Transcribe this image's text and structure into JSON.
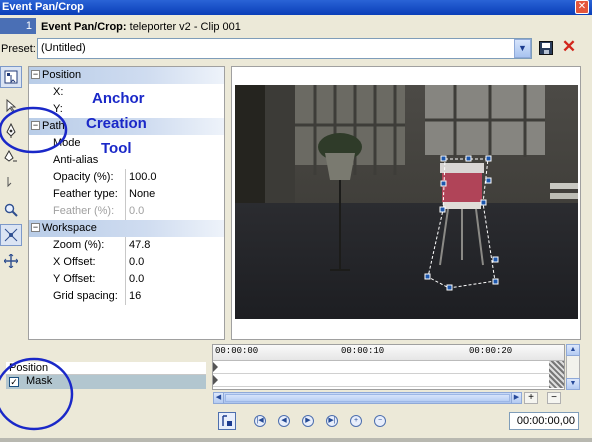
{
  "window": {
    "title": "Event Pan/Crop",
    "track_chip": "1"
  },
  "header": {
    "title_bold": "Event Pan/Crop:",
    "title_rest": " teleporter v2 - Clip 001"
  },
  "preset": {
    "label": "Preset:",
    "value": "(Untitled)"
  },
  "toolbar": {
    "tools": [
      "normal-edit-tool-icon",
      "pointer-tool-icon",
      "anchor-creation-tool-icon",
      "split-anchor-tool-icon",
      "delete-anchor-tool-icon",
      "zoom-tool-icon",
      "enable-snapping-icon",
      "move-freely-icon"
    ]
  },
  "properties": {
    "sections": [
      {
        "name": "Position",
        "rows": [
          {
            "key": "X:",
            "value": ""
          },
          {
            "key": "Y:",
            "value": ""
          }
        ]
      },
      {
        "name": "Path",
        "rows": [
          {
            "key": "Mode",
            "value": ""
          },
          {
            "key": "Anti-alias",
            "value": ""
          },
          {
            "key": "Opacity (%):",
            "value": "100.0"
          },
          {
            "key": "Feather type:",
            "value": "None"
          },
          {
            "key": "Feather (%):",
            "value": "0.0",
            "disabled": true
          }
        ]
      },
      {
        "name": "Workspace",
        "rows": [
          {
            "key": "Zoom (%):",
            "value": "47.8"
          },
          {
            "key": "X Offset:",
            "value": "0.0"
          },
          {
            "key": "Y Offset:",
            "value": "0.0"
          },
          {
            "key": "Grid spacing:",
            "value": "16"
          }
        ]
      }
    ]
  },
  "annotation": {
    "line1": "Anchor",
    "line2": "Creation",
    "line3": "Tool",
    "color": "#1a28c8"
  },
  "tracks": {
    "position": "Position",
    "mask": "Mask",
    "mask_checked": "✓"
  },
  "timeline": {
    "ruler": [
      "00:00:00",
      "00:00:10",
      "00:00:20"
    ],
    "timecode": "00:00:00,00"
  },
  "transport": [
    "animate-icon",
    "first-keyframe-icon",
    "previous-keyframe-icon",
    "next-keyframe-icon",
    "last-keyframe-icon",
    "add-keyframe-icon",
    "delete-keyframe-icon"
  ],
  "colors": {
    "title_bar": "#0a3eb8",
    "accent": "#1a28c8",
    "delete": "#d2261c"
  }
}
